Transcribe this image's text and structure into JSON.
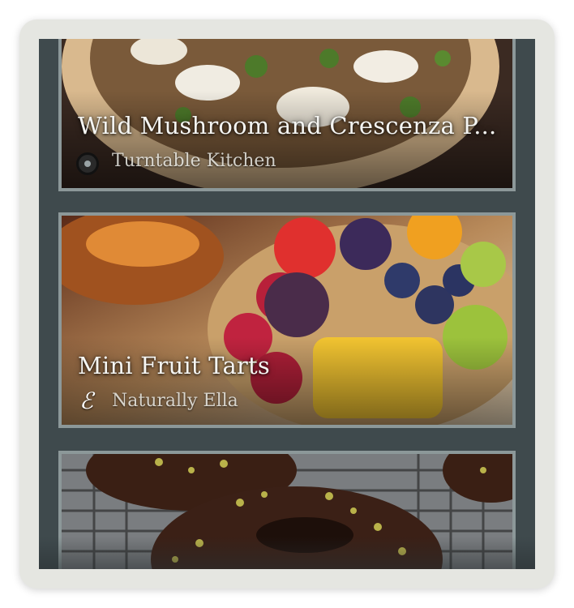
{
  "recipes": [
    {
      "title": "Wild Mushroom and Crescenza P...",
      "source": "Turntable Kitchen",
      "source_icon": "turntable-logo-icon"
    },
    {
      "title": "Mini Fruit Tarts",
      "source": "Naturally Ella",
      "source_icon": "naturally-ella-logo-icon",
      "source_logo_glyph": "ℰ"
    },
    {
      "title": "",
      "source": "",
      "source_icon": ""
    }
  ],
  "colors": {
    "frame": "#e5e6e1",
    "screen_bg": "#3f4a4d",
    "card_border": "#8c9899"
  }
}
